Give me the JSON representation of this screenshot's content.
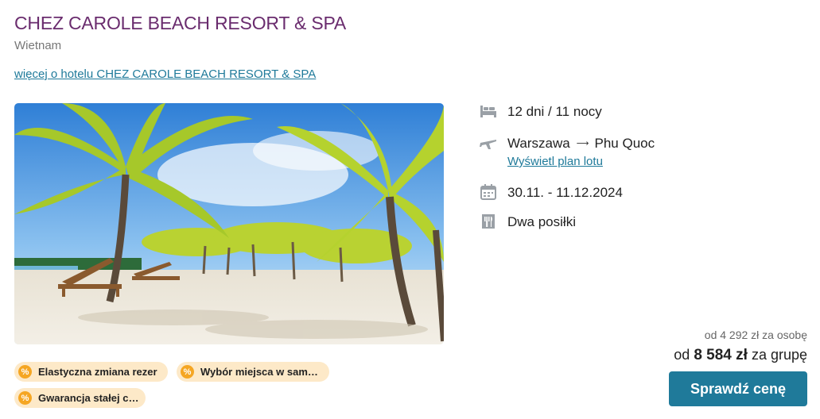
{
  "hotel": {
    "name": "CHEZ CAROLE BEACH RESORT & SPA",
    "country": "Wietnam",
    "more_link": "więcej o hotelu CHEZ CAROLE BEACH RESORT & SPA"
  },
  "details": {
    "duration": "12 dni / 11 nocy",
    "route_from": "Warszawa",
    "route_arrow": "⟶",
    "route_to": "Phu Quoc",
    "flight_plan_link": "Wyświetl plan lotu",
    "dates": "30.11. - 11.12.2024",
    "board": "Dwa posiłki"
  },
  "icons": {
    "duration": "bed-icon",
    "route": "plane-icon",
    "dates": "calendar-icon",
    "board": "meal-icon",
    "badge": "discount-percent-icon"
  },
  "badges": [
    {
      "text": "Elastyczna zmiana rezer",
      "icon_glyph": "%"
    },
    {
      "text": "Wybór miejsca w samolo",
      "icon_glyph": "%"
    },
    {
      "text": "Gwarancja stałej ceny",
      "icon_glyph": "%"
    }
  ],
  "price": {
    "per_person": "od 4 292 zł za osobę",
    "group_prefix": "od ",
    "group_amount": "8 584 zł",
    "group_suffix": " za grupę"
  },
  "cta": {
    "label": "Sprawdź cenę"
  },
  "colors": {
    "title": "#6a2c6e",
    "link": "#1f7a9a",
    "button": "#1f7a9a",
    "badge_bg": "#fde9c8",
    "badge_icon": "#f5a623"
  }
}
